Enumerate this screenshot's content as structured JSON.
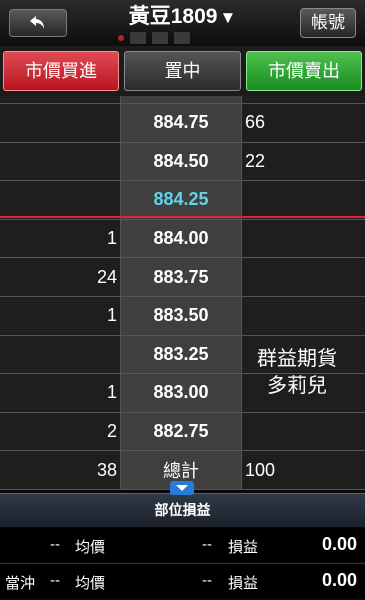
{
  "header": {
    "title": "黃豆1809",
    "dropdown_glyph": "▼",
    "back_icon": "back-arrow-icon",
    "account_label": "帳號"
  },
  "actions": {
    "buy_market": "市價買進",
    "center": "置中",
    "sell_market": "市價賣出",
    "buy_color": "#c8202a",
    "sell_color": "#22a02a"
  },
  "book": {
    "rows": [
      {
        "bid": "",
        "price": "884.75",
        "ask": "66"
      },
      {
        "bid": "",
        "price": "884.50",
        "ask": "22"
      },
      {
        "bid": "",
        "price": "884.25",
        "ask": ""
      },
      {
        "bid": "1",
        "price": "884.00",
        "ask": ""
      },
      {
        "bid": "24",
        "price": "883.75",
        "ask": ""
      },
      {
        "bid": "1",
        "price": "883.50",
        "ask": ""
      },
      {
        "bid": "",
        "price": "883.25",
        "ask": ""
      },
      {
        "bid": "1",
        "price": "883.00",
        "ask": ""
      },
      {
        "bid": "2",
        "price": "882.75",
        "ask": ""
      },
      {
        "bid": "38",
        "price": "總計",
        "ask": "100"
      }
    ],
    "last_price_color": "#5fd3e8",
    "watermark_line1": "群益期貨",
    "watermark_line2": "多莉兒"
  },
  "position": {
    "title": "部位損益",
    "row1": {
      "label": "",
      "avg_value": "--",
      "avg_label": "均價",
      "pnl_dash": "--",
      "pnl_label": "損益",
      "pnl_value": "0.00"
    },
    "row2": {
      "label": "當沖",
      "avg_value": "--",
      "avg_label": "均價",
      "pnl_dash": "--",
      "pnl_label": "損益",
      "pnl_value": "0.00"
    }
  }
}
